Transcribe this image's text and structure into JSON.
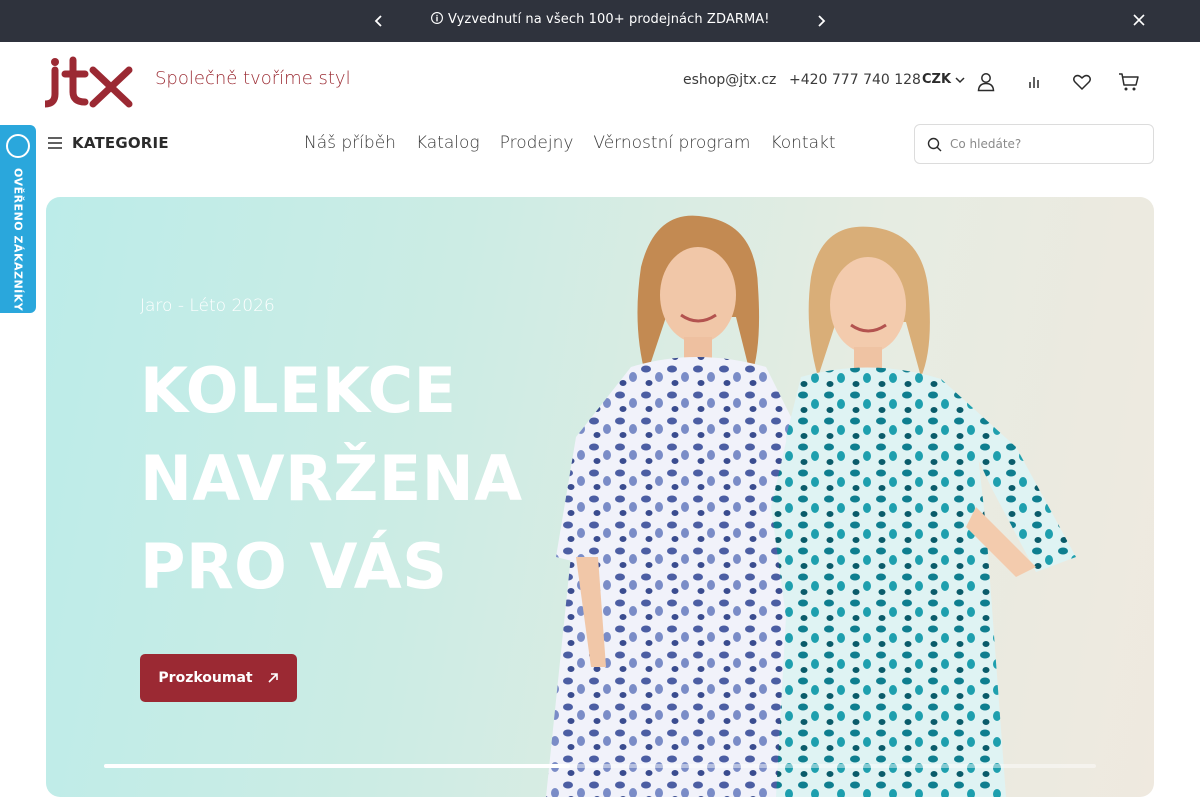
{
  "announcement": {
    "text": "🛈 Vyzvednutí na všech 100+ prodejnách ZDARMA!",
    "prev_icon": "chevron-left-icon",
    "next_icon": "chevron-right-icon",
    "close_icon": "close-icon"
  },
  "header": {
    "logo_text": "jtx",
    "tagline": "Společně tvoříme styl",
    "email": "eshop@jtx.cz",
    "phone": "+420 777 740 128",
    "currency": "CZK",
    "icons": [
      "user-icon",
      "compare-icon",
      "heart-icon",
      "cart-icon"
    ]
  },
  "nav": {
    "categories_label": "KATEGORIE",
    "items": [
      {
        "label": "Náš příběh"
      },
      {
        "label": "Katalog"
      },
      {
        "label": "Prodejny"
      },
      {
        "label": "Věrnostní program"
      },
      {
        "label": "Kontakt"
      }
    ],
    "search_placeholder": "Co hledáte?"
  },
  "side_badge": {
    "label": "OVĚŘENO ZÁKAZNÍKY"
  },
  "hero": {
    "season": "Jaro - Léto 2026",
    "headline_lines": [
      "KOLEKCE",
      "NAVRŽENA",
      "PRO VÁS"
    ],
    "cta_label": "Prozkoumat",
    "slider_progress": 0.47
  },
  "colors": {
    "brand": "#9b2933",
    "topbar": "#2f333d",
    "badge": "#2aa7dc"
  }
}
